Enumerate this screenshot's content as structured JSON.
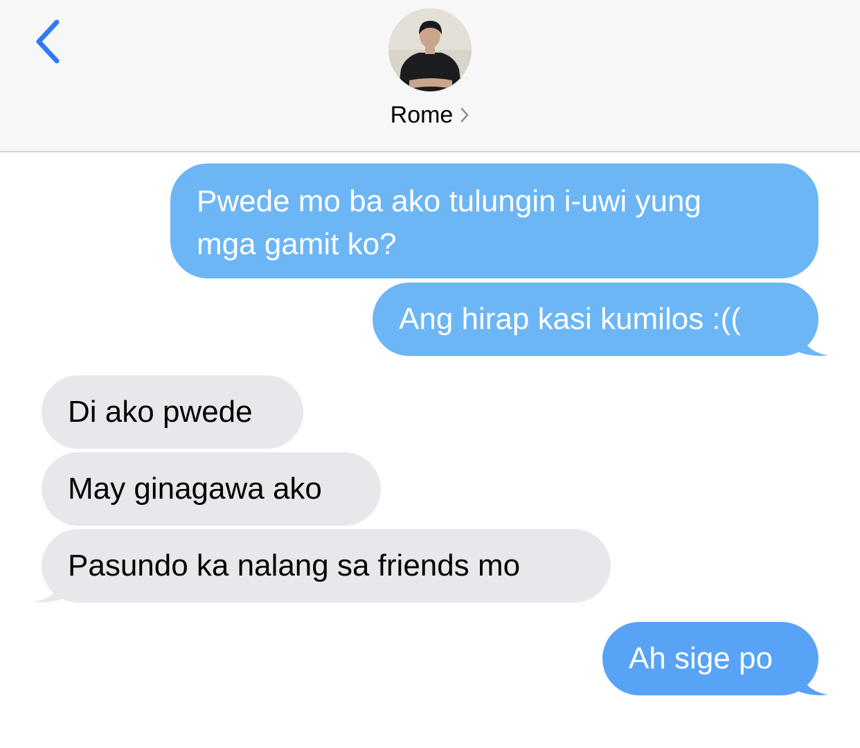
{
  "header": {
    "back_icon": "chevron-left-icon",
    "contact_name": "Rome",
    "contact_chevron_icon": "chevron-right-icon",
    "accent_color": "#2f7bf6"
  },
  "messages": [
    {
      "direction": "sent",
      "text_lines": [
        "Pwede mo ba ako tulungin i-uwi yung",
        "mga gamit ko?"
      ]
    },
    {
      "direction": "sent",
      "text": "Ang hirap kasi kumilos :(("
    },
    {
      "direction": "received",
      "text": "Di ako pwede"
    },
    {
      "direction": "received",
      "text": "May ginagawa ako"
    },
    {
      "direction": "received",
      "text": "Pasundo ka nalang sa friends mo"
    },
    {
      "direction": "sent",
      "text": "Ah sige po"
    }
  ],
  "colors": {
    "sent_bubble": "#6cb6f5",
    "received_bubble": "#e8e8ec",
    "header_bg": "#f7f7f7"
  }
}
